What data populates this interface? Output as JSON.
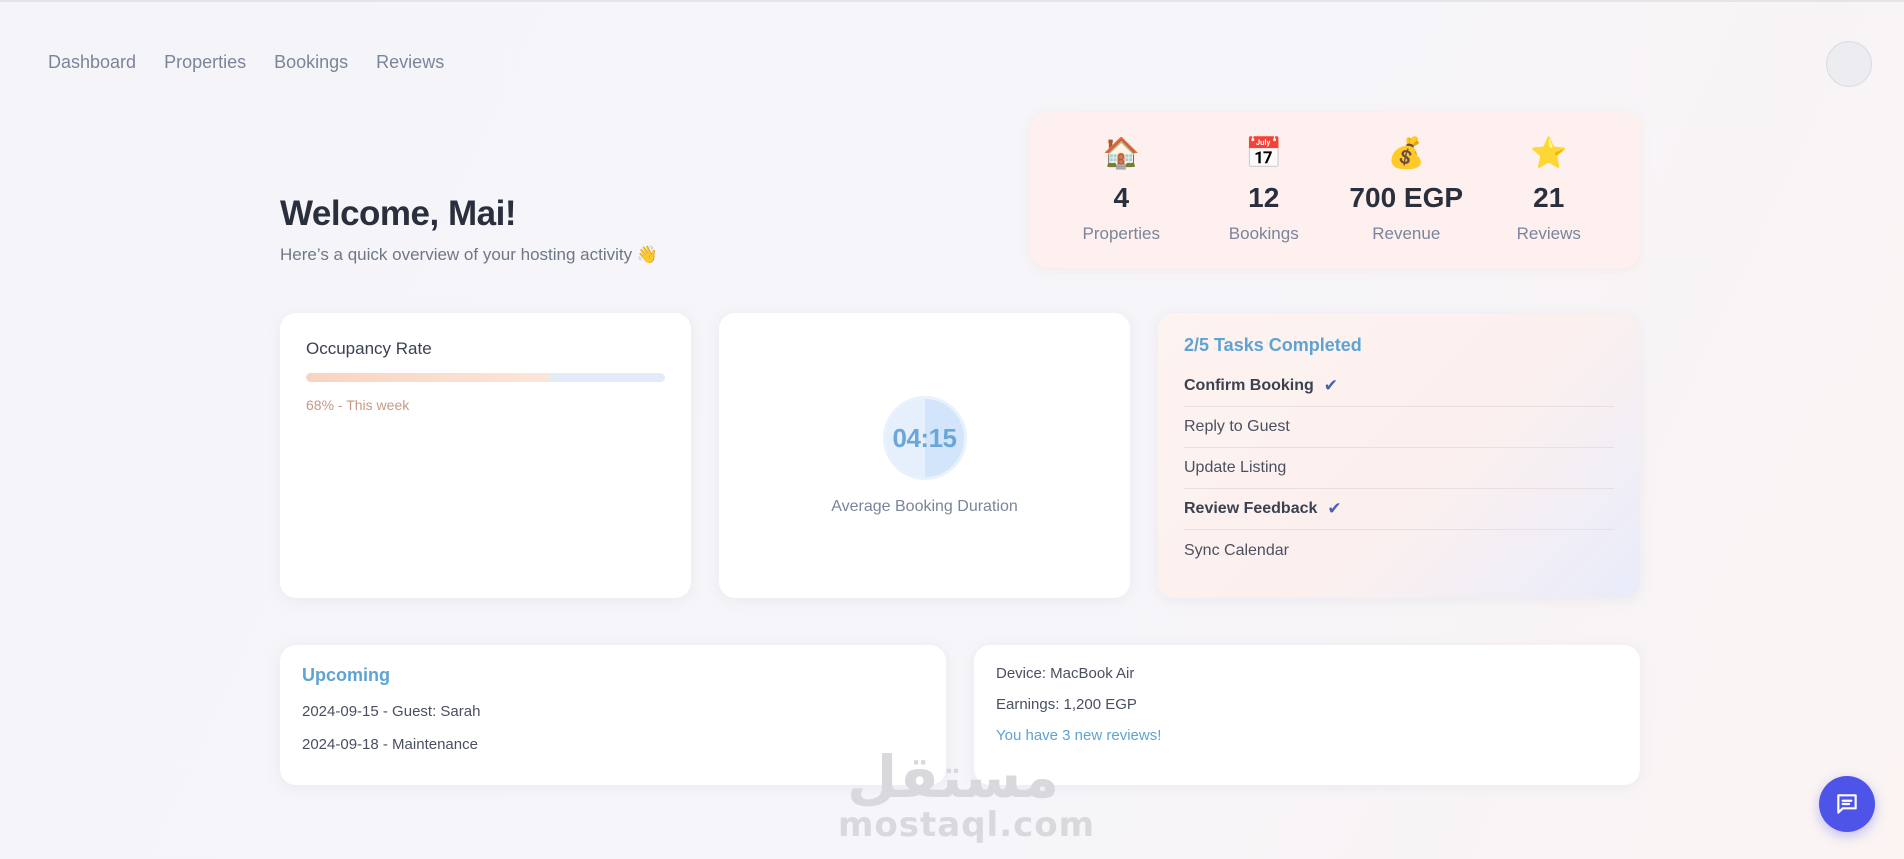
{
  "nav": {
    "items": [
      "Dashboard",
      "Properties",
      "Bookings",
      "Reviews"
    ]
  },
  "welcome": {
    "title": "Welcome, Mai!",
    "subtitle": "Here’s a quick overview of your hosting activity 👋"
  },
  "stats": [
    {
      "icon": "house-icon",
      "glyph": "🏠",
      "value": "4",
      "label": "Properties"
    },
    {
      "icon": "calendar-icon",
      "glyph": "📅",
      "value": "12",
      "label": "Bookings"
    },
    {
      "icon": "money-bag-icon",
      "glyph": "💰",
      "value": "700 EGP",
      "label": "Revenue"
    },
    {
      "icon": "star-icon",
      "glyph": "⭐",
      "value": "21",
      "label": "Reviews"
    }
  ],
  "occupancy": {
    "title": "Occupancy Rate",
    "percent": 68,
    "note": "68% - This week"
  },
  "duration": {
    "timer": "04:15",
    "label": "Average Booking Duration"
  },
  "tasks": {
    "title": "2/5 Tasks Completed",
    "items": [
      {
        "label": "Confirm Booking",
        "done": true
      },
      {
        "label": "Reply to Guest",
        "done": false
      },
      {
        "label": "Update Listing",
        "done": false
      },
      {
        "label": "Review Feedback",
        "done": true
      },
      {
        "label": "Sync Calendar",
        "done": false
      }
    ],
    "check_glyph": "✔"
  },
  "upcoming": {
    "title": "Upcoming",
    "items": [
      "2024-09-15 - Guest: Sarah",
      "2024-09-18 - Maintenance"
    ]
  },
  "device": {
    "device": "Device: MacBook Air",
    "earnings": "Earnings: 1,200 EGP",
    "reviews_link": "You have 3 new reviews!"
  },
  "watermark": {
    "arabic": "مستقل",
    "latin": "mostaql.com"
  },
  "colors": {
    "accent_blue": "#5ea3d3",
    "chat_button": "#4f54e8",
    "check": "#4b5fb3",
    "stats_bg": "#fdf0ee"
  }
}
